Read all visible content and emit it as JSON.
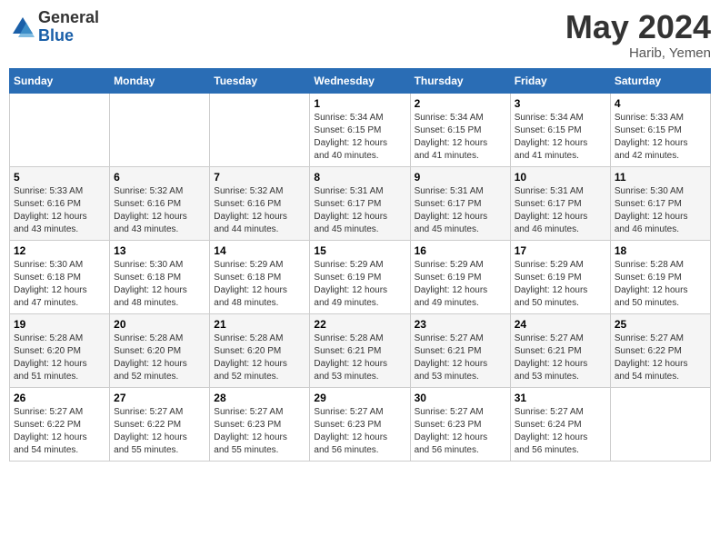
{
  "header": {
    "logo_line1": "General",
    "logo_line2": "Blue",
    "month_title": "May 2024",
    "location": "Harib, Yemen"
  },
  "weekdays": [
    "Sunday",
    "Monday",
    "Tuesday",
    "Wednesday",
    "Thursday",
    "Friday",
    "Saturday"
  ],
  "weeks": [
    [
      {
        "day": "",
        "info": ""
      },
      {
        "day": "",
        "info": ""
      },
      {
        "day": "",
        "info": ""
      },
      {
        "day": "1",
        "info": "Sunrise: 5:34 AM\nSunset: 6:15 PM\nDaylight: 12 hours\nand 40 minutes."
      },
      {
        "day": "2",
        "info": "Sunrise: 5:34 AM\nSunset: 6:15 PM\nDaylight: 12 hours\nand 41 minutes."
      },
      {
        "day": "3",
        "info": "Sunrise: 5:34 AM\nSunset: 6:15 PM\nDaylight: 12 hours\nand 41 minutes."
      },
      {
        "day": "4",
        "info": "Sunrise: 5:33 AM\nSunset: 6:15 PM\nDaylight: 12 hours\nand 42 minutes."
      }
    ],
    [
      {
        "day": "5",
        "info": "Sunrise: 5:33 AM\nSunset: 6:16 PM\nDaylight: 12 hours\nand 43 minutes."
      },
      {
        "day": "6",
        "info": "Sunrise: 5:32 AM\nSunset: 6:16 PM\nDaylight: 12 hours\nand 43 minutes."
      },
      {
        "day": "7",
        "info": "Sunrise: 5:32 AM\nSunset: 6:16 PM\nDaylight: 12 hours\nand 44 minutes."
      },
      {
        "day": "8",
        "info": "Sunrise: 5:31 AM\nSunset: 6:17 PM\nDaylight: 12 hours\nand 45 minutes."
      },
      {
        "day": "9",
        "info": "Sunrise: 5:31 AM\nSunset: 6:17 PM\nDaylight: 12 hours\nand 45 minutes."
      },
      {
        "day": "10",
        "info": "Sunrise: 5:31 AM\nSunset: 6:17 PM\nDaylight: 12 hours\nand 46 minutes."
      },
      {
        "day": "11",
        "info": "Sunrise: 5:30 AM\nSunset: 6:17 PM\nDaylight: 12 hours\nand 46 minutes."
      }
    ],
    [
      {
        "day": "12",
        "info": "Sunrise: 5:30 AM\nSunset: 6:18 PM\nDaylight: 12 hours\nand 47 minutes."
      },
      {
        "day": "13",
        "info": "Sunrise: 5:30 AM\nSunset: 6:18 PM\nDaylight: 12 hours\nand 48 minutes."
      },
      {
        "day": "14",
        "info": "Sunrise: 5:29 AM\nSunset: 6:18 PM\nDaylight: 12 hours\nand 48 minutes."
      },
      {
        "day": "15",
        "info": "Sunrise: 5:29 AM\nSunset: 6:19 PM\nDaylight: 12 hours\nand 49 minutes."
      },
      {
        "day": "16",
        "info": "Sunrise: 5:29 AM\nSunset: 6:19 PM\nDaylight: 12 hours\nand 49 minutes."
      },
      {
        "day": "17",
        "info": "Sunrise: 5:29 AM\nSunset: 6:19 PM\nDaylight: 12 hours\nand 50 minutes."
      },
      {
        "day": "18",
        "info": "Sunrise: 5:28 AM\nSunset: 6:19 PM\nDaylight: 12 hours\nand 50 minutes."
      }
    ],
    [
      {
        "day": "19",
        "info": "Sunrise: 5:28 AM\nSunset: 6:20 PM\nDaylight: 12 hours\nand 51 minutes."
      },
      {
        "day": "20",
        "info": "Sunrise: 5:28 AM\nSunset: 6:20 PM\nDaylight: 12 hours\nand 52 minutes."
      },
      {
        "day": "21",
        "info": "Sunrise: 5:28 AM\nSunset: 6:20 PM\nDaylight: 12 hours\nand 52 minutes."
      },
      {
        "day": "22",
        "info": "Sunrise: 5:28 AM\nSunset: 6:21 PM\nDaylight: 12 hours\nand 53 minutes."
      },
      {
        "day": "23",
        "info": "Sunrise: 5:27 AM\nSunset: 6:21 PM\nDaylight: 12 hours\nand 53 minutes."
      },
      {
        "day": "24",
        "info": "Sunrise: 5:27 AM\nSunset: 6:21 PM\nDaylight: 12 hours\nand 53 minutes."
      },
      {
        "day": "25",
        "info": "Sunrise: 5:27 AM\nSunset: 6:22 PM\nDaylight: 12 hours\nand 54 minutes."
      }
    ],
    [
      {
        "day": "26",
        "info": "Sunrise: 5:27 AM\nSunset: 6:22 PM\nDaylight: 12 hours\nand 54 minutes."
      },
      {
        "day": "27",
        "info": "Sunrise: 5:27 AM\nSunset: 6:22 PM\nDaylight: 12 hours\nand 55 minutes."
      },
      {
        "day": "28",
        "info": "Sunrise: 5:27 AM\nSunset: 6:23 PM\nDaylight: 12 hours\nand 55 minutes."
      },
      {
        "day": "29",
        "info": "Sunrise: 5:27 AM\nSunset: 6:23 PM\nDaylight: 12 hours\nand 56 minutes."
      },
      {
        "day": "30",
        "info": "Sunrise: 5:27 AM\nSunset: 6:23 PM\nDaylight: 12 hours\nand 56 minutes."
      },
      {
        "day": "31",
        "info": "Sunrise: 5:27 AM\nSunset: 6:24 PM\nDaylight: 12 hours\nand 56 minutes."
      },
      {
        "day": "",
        "info": ""
      }
    ]
  ]
}
